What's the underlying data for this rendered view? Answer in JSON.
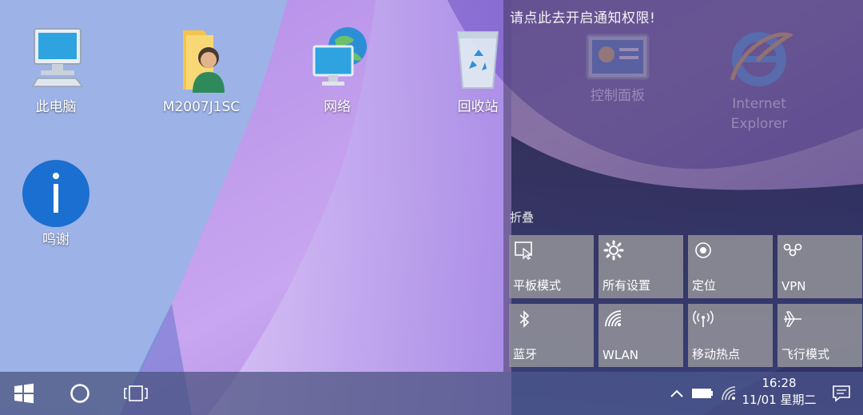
{
  "desktop": {
    "icons": [
      {
        "label": "此电脑"
      },
      {
        "label": "M2007J1SC"
      },
      {
        "label": "网络"
      },
      {
        "label": "回收站"
      },
      {
        "label": "鸣谢"
      }
    ]
  },
  "action_center": {
    "notification_prompt": "请点此去开启通知权限!",
    "faded_icons": [
      {
        "label": "控制面板"
      },
      {
        "label_line1": "Internet",
        "label_line2": "Explorer"
      }
    ],
    "collapse_label": "折叠",
    "tiles": [
      {
        "label": "平板模式",
        "icon": "tablet-mode-icon"
      },
      {
        "label": "所有设置",
        "icon": "gear-icon"
      },
      {
        "label": "定位",
        "icon": "location-icon"
      },
      {
        "label": "VPN",
        "icon": "vpn-icon"
      },
      {
        "label": "蓝牙",
        "icon": "bluetooth-icon"
      },
      {
        "label": "WLAN",
        "icon": "wifi-icon"
      },
      {
        "label": "移动热点",
        "icon": "hotspot-icon"
      },
      {
        "label": "飞行模式",
        "icon": "airplane-icon"
      }
    ]
  },
  "taskbar": {
    "clock_time": "16:28",
    "clock_date": "11/01 星期二"
  },
  "colors": {
    "tile_bg": "#8c8c96",
    "taskbar_bg": "#465080",
    "info_icon_blue": "#1a6fd0"
  }
}
